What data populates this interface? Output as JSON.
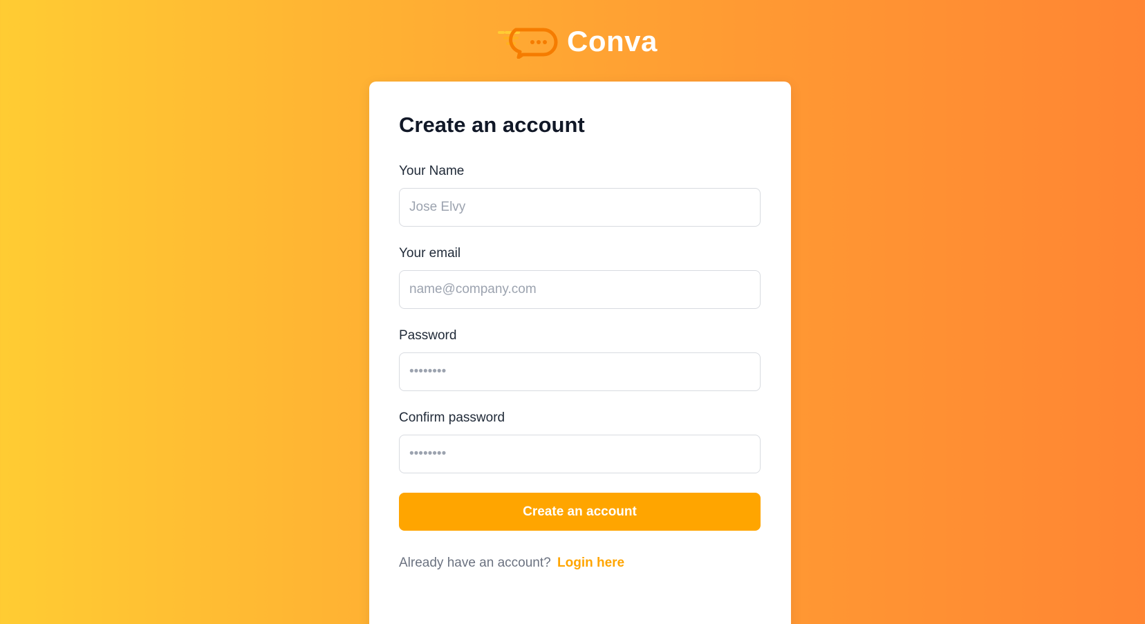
{
  "brand": {
    "name": "Conva",
    "logo_icon": "chat-bubble-logo-icon"
  },
  "colors": {
    "accent": "#ffa500",
    "background_start": "#ffcc33",
    "background_end": "#ff8533"
  },
  "form": {
    "title": "Create an account",
    "fields": [
      {
        "label": "Your Name",
        "placeholder": "Jose Elvy",
        "type": "text"
      },
      {
        "label": "Your email",
        "placeholder": "name@company.com",
        "type": "email"
      },
      {
        "label": "Password",
        "placeholder": "••••••••",
        "type": "password"
      },
      {
        "label": "Confirm password",
        "placeholder": "••••••••",
        "type": "password"
      }
    ],
    "submit_label": "Create an account",
    "login_prompt": "Already have an account?",
    "login_link": "Login here"
  }
}
